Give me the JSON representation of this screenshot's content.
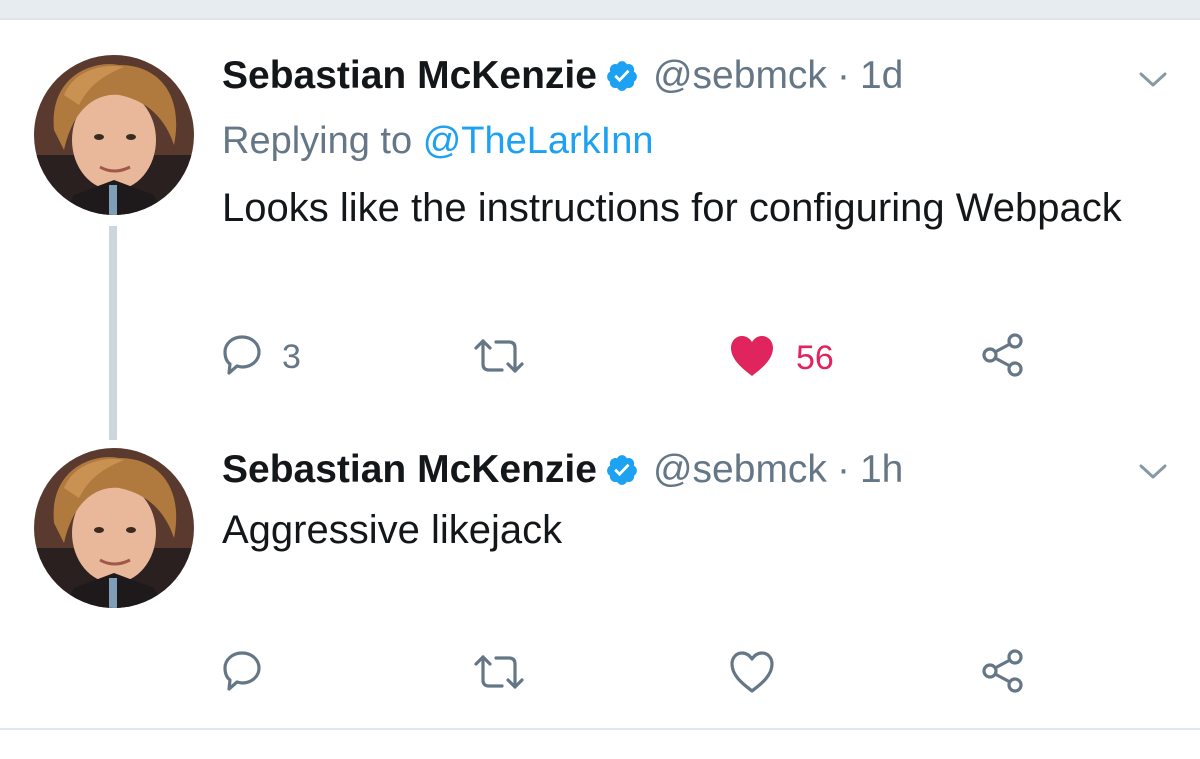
{
  "tweets": [
    {
      "name": "Sebastian McKenzie",
      "handle": "@sebmck",
      "separator": "·",
      "time": "1d",
      "reply_prefix": "Replying to",
      "reply_to": "@TheLarkInn",
      "text": "Looks like the instructions for configuring Webpack",
      "actions": {
        "reply_count": "3",
        "retweet_count": "",
        "like_count": "56",
        "liked": true
      }
    },
    {
      "name": "Sebastian McKenzie",
      "handle": "@sebmck",
      "separator": "·",
      "time": "1h",
      "text": "Aggressive likejack",
      "actions": {
        "reply_count": "",
        "retweet_count": "",
        "like_count": "",
        "liked": false
      }
    }
  ],
  "icons": {
    "verified": "verified-badge-icon",
    "more": "chevron-down-icon",
    "reply": "reply-icon",
    "retweet": "retweet-icon",
    "like": "heart-icon",
    "share": "share-icon"
  },
  "colors": {
    "name": "#14171a",
    "secondary": "#657786",
    "link": "#1da1f2",
    "liked": "#e0245e",
    "verified": "#1da1f2",
    "thread_line": "#ccd6dd"
  }
}
